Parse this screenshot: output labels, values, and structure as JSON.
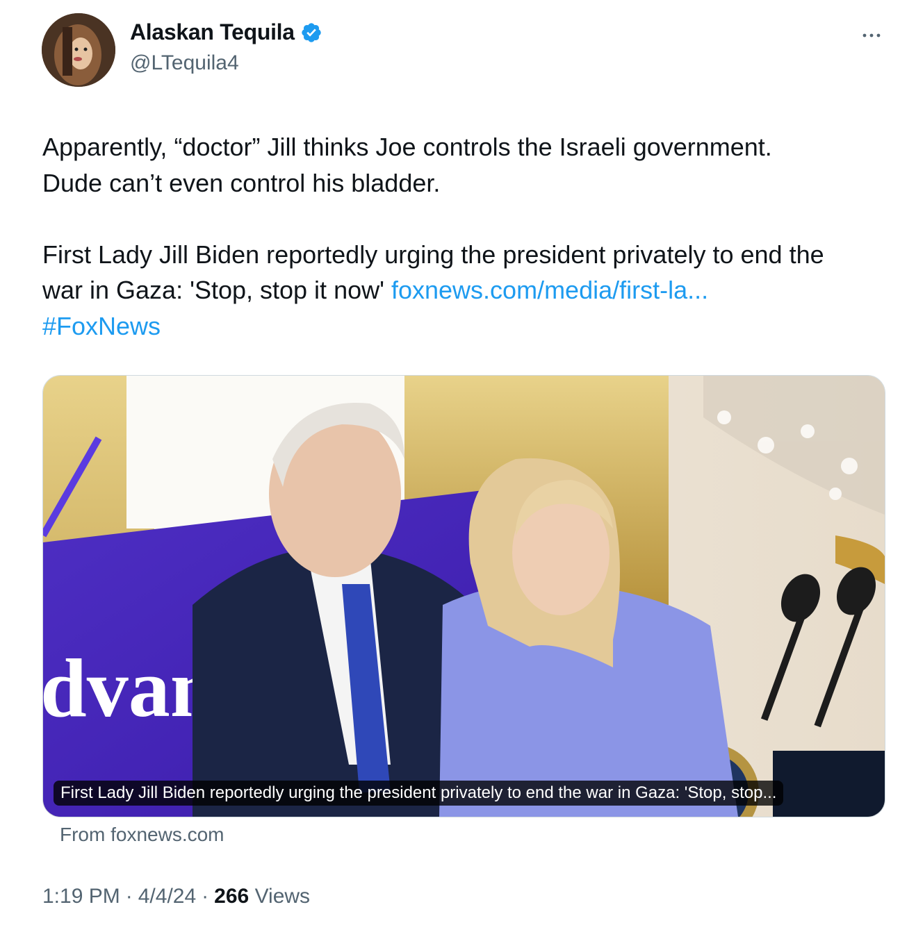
{
  "author": {
    "display_name": "Alaskan Tequila",
    "handle": "@LTequila4",
    "verified": true,
    "avatar_icon": "profile-photo"
  },
  "icons": {
    "verified": "verified-badge-icon",
    "more": "more-options-icon"
  },
  "colors": {
    "link": "#1d9bf0",
    "secondary_text": "#536471",
    "verified_blue": "#1d9bf0"
  },
  "tweet": {
    "line1": "Apparently, “doctor” Jill thinks Joe controls the Israeli government.",
    "line2": "Dude can’t even control his bladder.",
    "line3": "First Lady Jill Biden reportedly urging the president privately to end the",
    "line4_text": "war in Gaza: 'Stop, stop it now' ",
    "line4_link": "foxnews.com/media/first-la...",
    "hashtag": "#FoxNews"
  },
  "card": {
    "caption": "First Lady Jill Biden reportedly urging the president privately to end the war in Gaza: 'Stop, stop...",
    "source": "From foxnews.com",
    "banner_text": "dvan"
  },
  "meta": {
    "time": "1:19 PM",
    "sep1": "·",
    "date": "4/4/24",
    "sep2": "·",
    "views_count": "266",
    "views_label": "Views"
  }
}
